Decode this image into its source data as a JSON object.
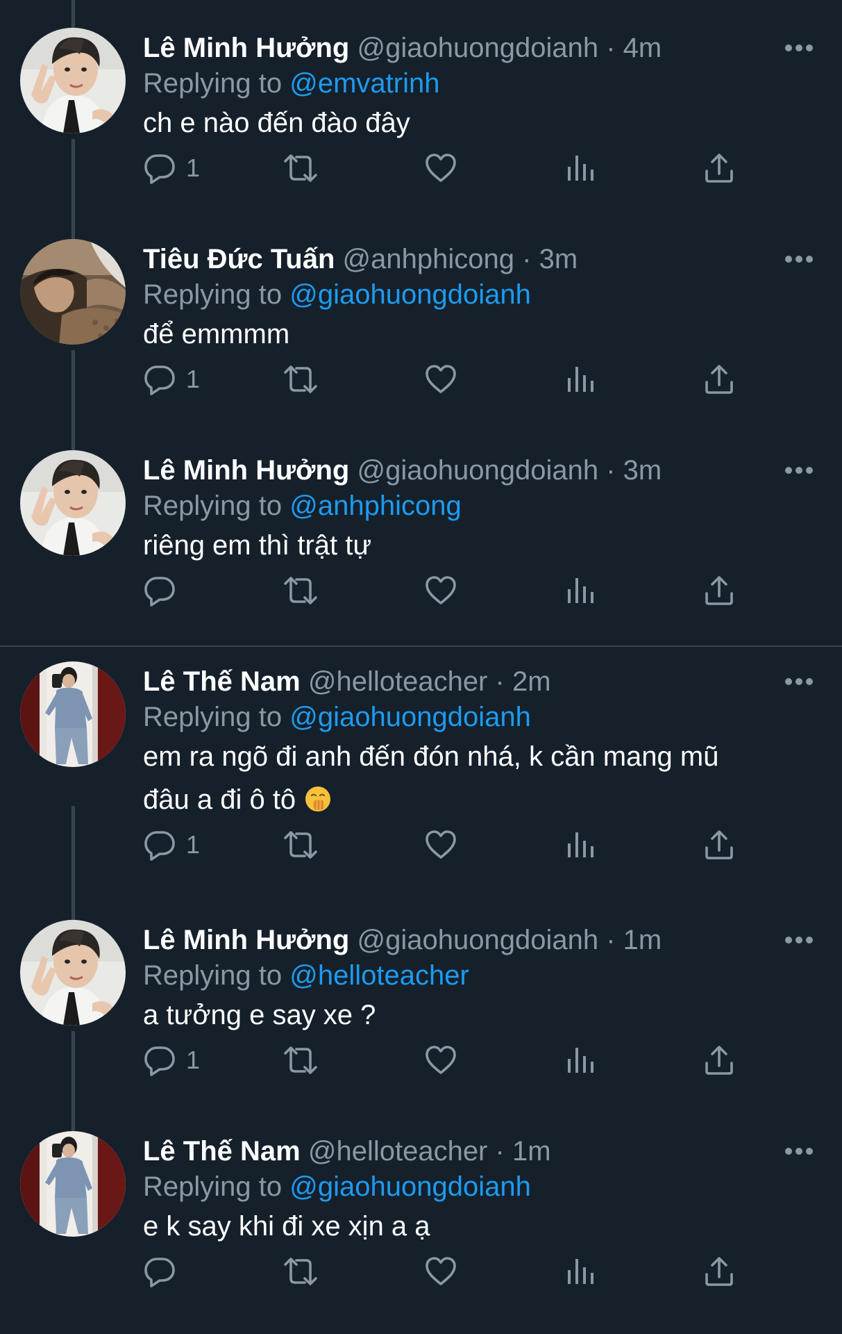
{
  "colors": {
    "background": "#15202b",
    "text_primary": "#ffffff",
    "text_secondary": "#8b98a5",
    "accent": "#1d9bf0",
    "border": "#38444d"
  },
  "icons": {
    "more": "more-horizontal-icon",
    "reply": "reply-icon",
    "retweet": "retweet-icon",
    "like": "heart-icon",
    "views": "views-icon",
    "share": "share-icon",
    "emoji": "shushing-face-emoji"
  },
  "tweets": [
    {
      "name": "Lê Minh Hưởng",
      "handle": "@giaohuongdoianh",
      "dot": "·",
      "time": "4m",
      "replying_prefix": "Replying to",
      "replying_to": "@emvatrinh",
      "text_lines": [
        "ch e nào đến đào đây"
      ],
      "reply_count": "1"
    },
    {
      "name": "Tiêu Đức Tuấn",
      "handle": "@anhphicong",
      "dot": "·",
      "time": "3m",
      "replying_prefix": "Replying to",
      "replying_to": "@giaohuongdoianh",
      "text_lines": [
        "để emmmm"
      ],
      "reply_count": "1"
    },
    {
      "name": "Lê Minh Hưởng",
      "handle": "@giaohuongdoianh",
      "dot": "·",
      "time": "3m",
      "replying_prefix": "Replying to",
      "replying_to": "@anhphicong",
      "text_lines": [
        "riêng em thì trật tự"
      ],
      "reply_count": ""
    },
    {
      "name": "Lê Thế Nam",
      "handle": "@helloteacher",
      "dot": "·",
      "time": "2m",
      "replying_prefix": "Replying to",
      "replying_to": "@giaohuongdoianh",
      "text_lines": [
        "em ra ngõ đi anh đến đón nhá, k cần mang mũ",
        "đâu a đi ô tô"
      ],
      "reply_count": "1"
    },
    {
      "name": "Lê Minh Hưởng",
      "handle": "@giaohuongdoianh",
      "dot": "·",
      "time": "1m",
      "replying_prefix": "Replying to",
      "replying_to": "@helloteacher",
      "text_lines": [
        "a tưởng e say xe ?"
      ],
      "reply_count": "1"
    },
    {
      "name": "Lê Thế Nam",
      "handle": "@helloteacher",
      "dot": "·",
      "time": "1m",
      "replying_prefix": "Replying to",
      "replying_to": "@giaohuongdoianh",
      "text_lines": [
        "e k say khi đi xe xịn a ạ"
      ],
      "reply_count": ""
    }
  ]
}
